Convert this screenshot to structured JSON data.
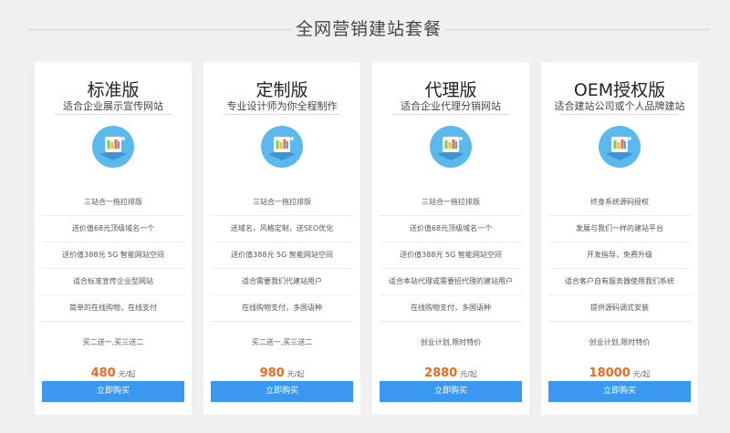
{
  "header": {
    "title": "全网营销建站套餐"
  },
  "colors": {
    "accent": "#3a98f1",
    "price": "#ee6a1f",
    "background": "#f0f0f0"
  },
  "plans": [
    {
      "name": "标准版",
      "subtitle": "适合企业展示宣传网站",
      "icon": "website-builder-icon",
      "features": [
        "三站合一拖拉排版",
        "送价值68元顶级域名一个",
        "送价值388元 5G 智能网站空间",
        "适合标准宣传企业型网站",
        "简单的在线购物，在线支付"
      ],
      "promo": "买二送一,买三送二",
      "price": "480",
      "price_unit": "元/起",
      "buy_label": "立即购买"
    },
    {
      "name": "定制版",
      "subtitle": "专业设计师为你全程制作",
      "icon": "website-builder-icon",
      "features": [
        "三站合一拖拉排版",
        "送域名，风格定制，送SEO优化",
        "送价值388元 5G 智能网站空间",
        "适合需要我们代建站用户",
        "在线购物支付，多国语种"
      ],
      "promo": "买二送一,买三送二",
      "price": "980",
      "price_unit": "元/起",
      "buy_label": "立即购买"
    },
    {
      "name": "代理版",
      "subtitle": "适合企业代理分销网站",
      "icon": "website-builder-icon",
      "features": [
        "三站合一拖拉排版",
        "送价值68元顶级域名一个",
        "送价值388元 5G 智能网站空间",
        "适合本站代理或需要招代理的建站用户",
        "在线购物支付，多国语种"
      ],
      "promo": "创业计划,限时特价",
      "price": "2880",
      "price_unit": "元/起",
      "buy_label": "立即购买"
    },
    {
      "name": "OEM授权版",
      "subtitle": "适合建站公司或个人品牌建站",
      "icon": "website-builder-icon",
      "features": [
        "终身系统源码授权",
        "发展与我们一样的建站平台",
        "开发指导，免费升级",
        "适合客户自有服务器使用我们系统",
        "提供源码调式安装"
      ],
      "promo": "创业计划,限时特价",
      "price": "18000",
      "price_unit": "元/起",
      "buy_label": "立即购买"
    }
  ]
}
